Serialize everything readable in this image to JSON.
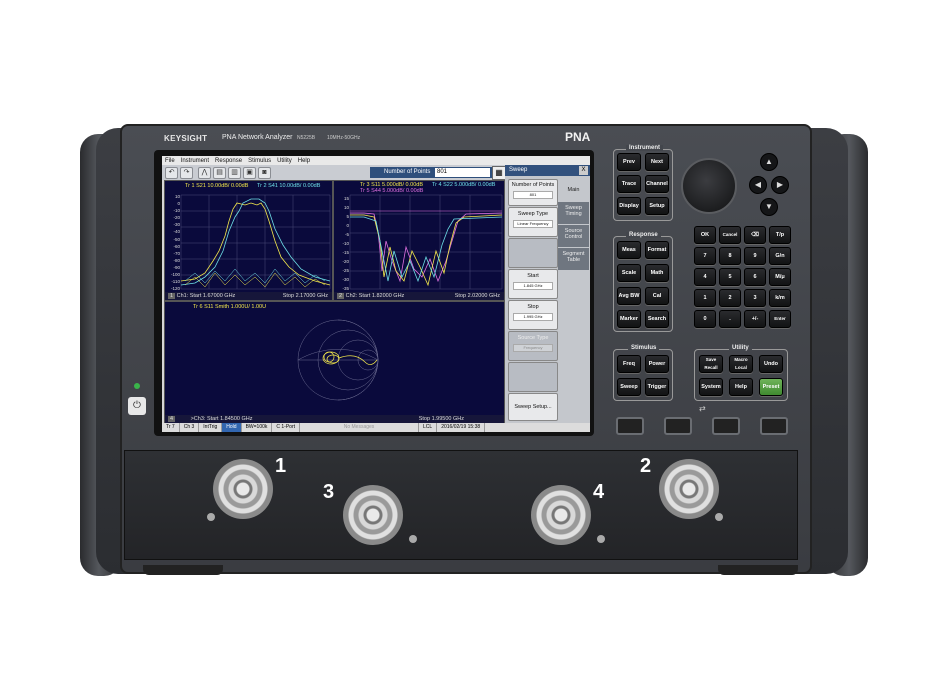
{
  "device": {
    "brand": "KEYSIGHT",
    "model_title": "PNA Network Analyzer",
    "model_number": "N5225B",
    "freq_range": "10MHz-50GHz",
    "badge": "PNA"
  },
  "menu": [
    "File",
    "Instrument",
    "Response",
    "Stimulus",
    "Utility",
    "Help"
  ],
  "toolbar": {
    "icons": [
      "undo-icon",
      "redo-icon",
      "marker-icon",
      "table-icon",
      "trash-icon",
      "camera-icon",
      "image-icon"
    ],
    "number_of_points_label": "Number of Points",
    "number_of_points_value": "801"
  },
  "windows": [
    {
      "title_a": "Tr 1  S21 10.00dB/ 0.00dB",
      "title_b": "Tr 2  S41 10.00dB/ 0.00dB",
      "footer_left": "Ch1: Start  1.67000 GHz",
      "footer_right": "Stop  2.17000 GHz",
      "num": "1",
      "y_ticks": [
        "10",
        "0",
        "-10",
        "-20",
        "-30",
        "-40",
        "-50",
        "-60",
        "-70",
        "-80",
        "-90",
        "-100",
        "-110",
        "-120"
      ]
    },
    {
      "title_a": "Tr 3  S11 5.000dB/ 0.00dB",
      "title_b": "Tr 4  S22 5.000dB/ 0.00dB",
      "title_c": "Tr 5  S44 5.000dB/ 0.00dB",
      "footer_left": "Ch2: Start  1.82000 GHz",
      "footer_right": "Stop  2.02000 GHz",
      "num": "2",
      "y_ticks": [
        "15",
        "10",
        "5",
        "0",
        "-5",
        "-10",
        "-15",
        "-20",
        "-25",
        "-30",
        "-35"
      ]
    },
    {
      "title_a": "Tr 6  S11 Smith 1.000U/ 1.00U",
      "footer_left": ">Ch3: Start  1.84500 GHz",
      "footer_right": "Stop  1.99500 GHz",
      "num": "4"
    }
  ],
  "sweep_panel": {
    "title": "Sweep",
    "close": "X",
    "softkeys": [
      {
        "label": "Number of Points",
        "value": "801"
      },
      {
        "label": "Sweep Type",
        "value": "Linear Frequency"
      },
      {
        "label": "",
        "value": ""
      },
      {
        "label": "Start",
        "value": "1.845 GHz"
      },
      {
        "label": "Stop",
        "value": "1.995 GHz"
      },
      {
        "label": "Source Type",
        "value": "Frequency"
      },
      {
        "label": "",
        "value": ""
      },
      {
        "label": "Sweep Setup...",
        "value": ""
      }
    ],
    "tabs": [
      "Main",
      "Sweep Timing",
      "Source Control",
      "Segment Table"
    ]
  },
  "status_bar": [
    "Tr 7",
    "Ch 3",
    "IntTrig",
    "Hold",
    "BW=100k",
    "C 1-Port",
    "No Messages",
    "LCL",
    "2016/02/19 15:38"
  ],
  "instrument_keys": {
    "title": "Instrument",
    "keys": [
      "Prev",
      "Next",
      "Trace",
      "Channel",
      "Display",
      "Setup"
    ]
  },
  "response_keys": {
    "title": "Response",
    "keys": [
      "Meas",
      "Format",
      "Scale",
      "Math",
      "Avg BW",
      "Cal",
      "Marker",
      "Search"
    ]
  },
  "stimulus_keys": {
    "title": "Stimulus",
    "keys": [
      "Freq",
      "Power",
      "Sweep",
      "Trigger"
    ]
  },
  "utility_keys": {
    "title": "Utility",
    "keys": [
      "Save Recall",
      "Macro Local",
      "Undo",
      "System",
      "Help",
      "Preset"
    ]
  },
  "numpad": [
    "OK",
    "Cancel",
    "⌫",
    "T/p",
    "7",
    "8",
    "9",
    "G/n",
    "4",
    "5",
    "6",
    "M/μ",
    "1",
    "2",
    "3",
    "k/m",
    "0",
    ".",
    "+/-",
    "Enter"
  ],
  "arrows": [
    "▲",
    "◀",
    "▶",
    "▼"
  ],
  "ports": [
    "1",
    "2",
    "3",
    "4"
  ],
  "colors": {
    "trace1": "#f4e94b",
    "trace2": "#6ee0e8",
    "trace3": "#f4e94b",
    "trace4": "#6ee0e8",
    "trace5": "#e070e0",
    "preset": "#4fa33f"
  }
}
